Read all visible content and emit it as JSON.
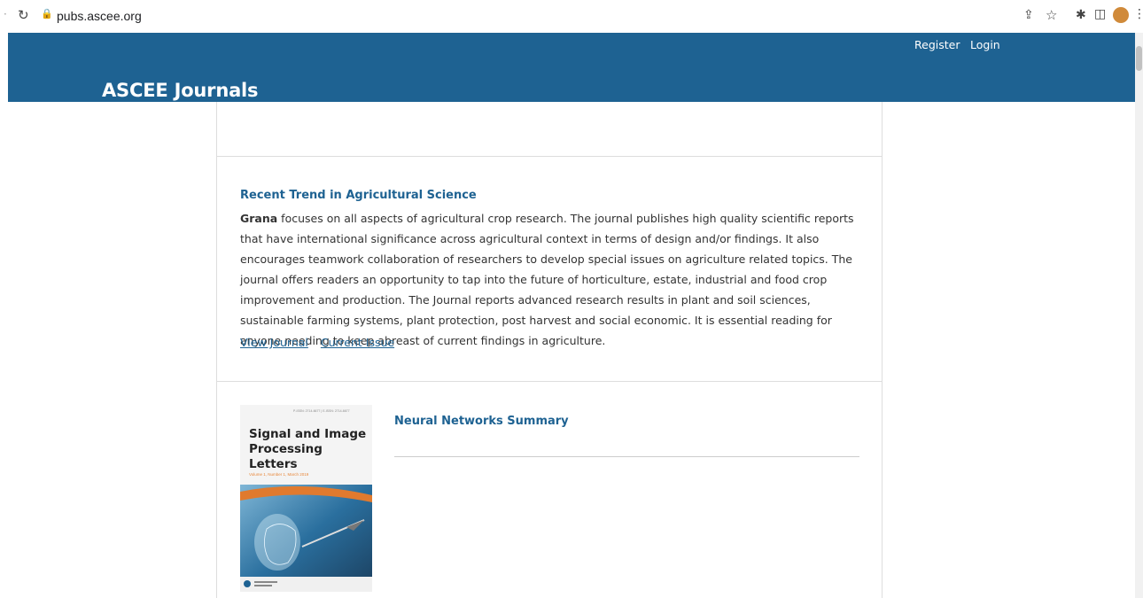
{
  "browser": {
    "url": "pubs.ascee.org"
  },
  "site": {
    "title": "ASCEE Journals",
    "nav": {
      "register": "Register",
      "login": "Login"
    }
  },
  "journals": [
    {
      "title": "Recent Trend in Agricultural Science",
      "description_bold": "Grana",
      "description_rest": " focuses on all aspects of agricultural crop research. The journal publishes high quality scientific reports that have international significance across agricultural context in terms of design and/or findings. It also encourages teamwork collaboration of researchers to develop special issues on agriculture related topics. The journal offers readers an opportunity to tap into the future of horticulture, estate, industrial and food crop improvement and production. The Journal reports advanced research results in plant and soil sciences, sustainable farming systems, plant protection, post harvest and social economic. It is essential reading for anyone needing to keep abreast of current findings in agriculture.",
      "links": [
        "View Journal",
        "Current Issue"
      ]
    },
    {
      "title": "Neural Networks Summary",
      "cover": {
        "issn": "P-ISSN: 2714-6677 | E-ISSN: 2714-6677",
        "title": "Signal and Image Processing Letters",
        "volume": "Volume 1, Number 1, March 2019"
      }
    }
  ],
  "colors": {
    "header_bg": "#1e6292",
    "link": "#1e6292"
  }
}
